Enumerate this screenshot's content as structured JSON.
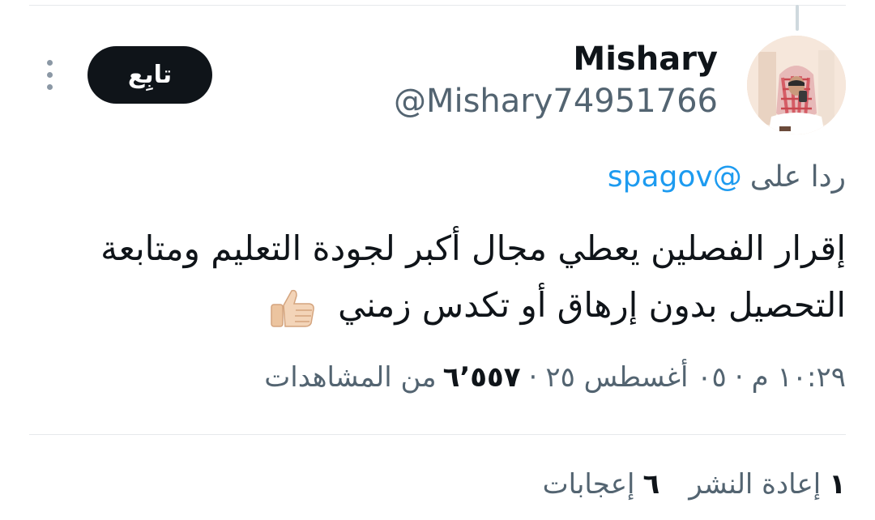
{
  "tweet": {
    "author": {
      "display_name": "Mishary",
      "handle": "@Mishary74951766",
      "avatar_icon": "user-avatar-photo"
    },
    "follow_label": "تابِع",
    "more_icon": "more-vertical-icon",
    "reply_prefix": "ردا على",
    "reply_to": "@spagov",
    "text": "إقرار الفصلين يعطي مجال أكبر لجودة التعليم ومتابعة التحصيل بدون إرهاق أو تكدس زمني",
    "emoji_icon": "thumbs-up-icon",
    "time": "١٠:٢٩ م",
    "date": "٠٥ أغسطس ٢٥",
    "separator": "·",
    "views_count": "٦٬٥٥٧",
    "views_label": "من المشاهدات"
  },
  "stats": {
    "retweets_count": "١",
    "retweets_label": "إعادة النشر",
    "likes_count": "٦",
    "likes_label": "إعجابات"
  },
  "colors": {
    "accent": "#1d9bf0",
    "text": "#0f1419",
    "secondary": "#536471",
    "divider": "#e6e9eb",
    "follow_bg": "#0f1419"
  }
}
